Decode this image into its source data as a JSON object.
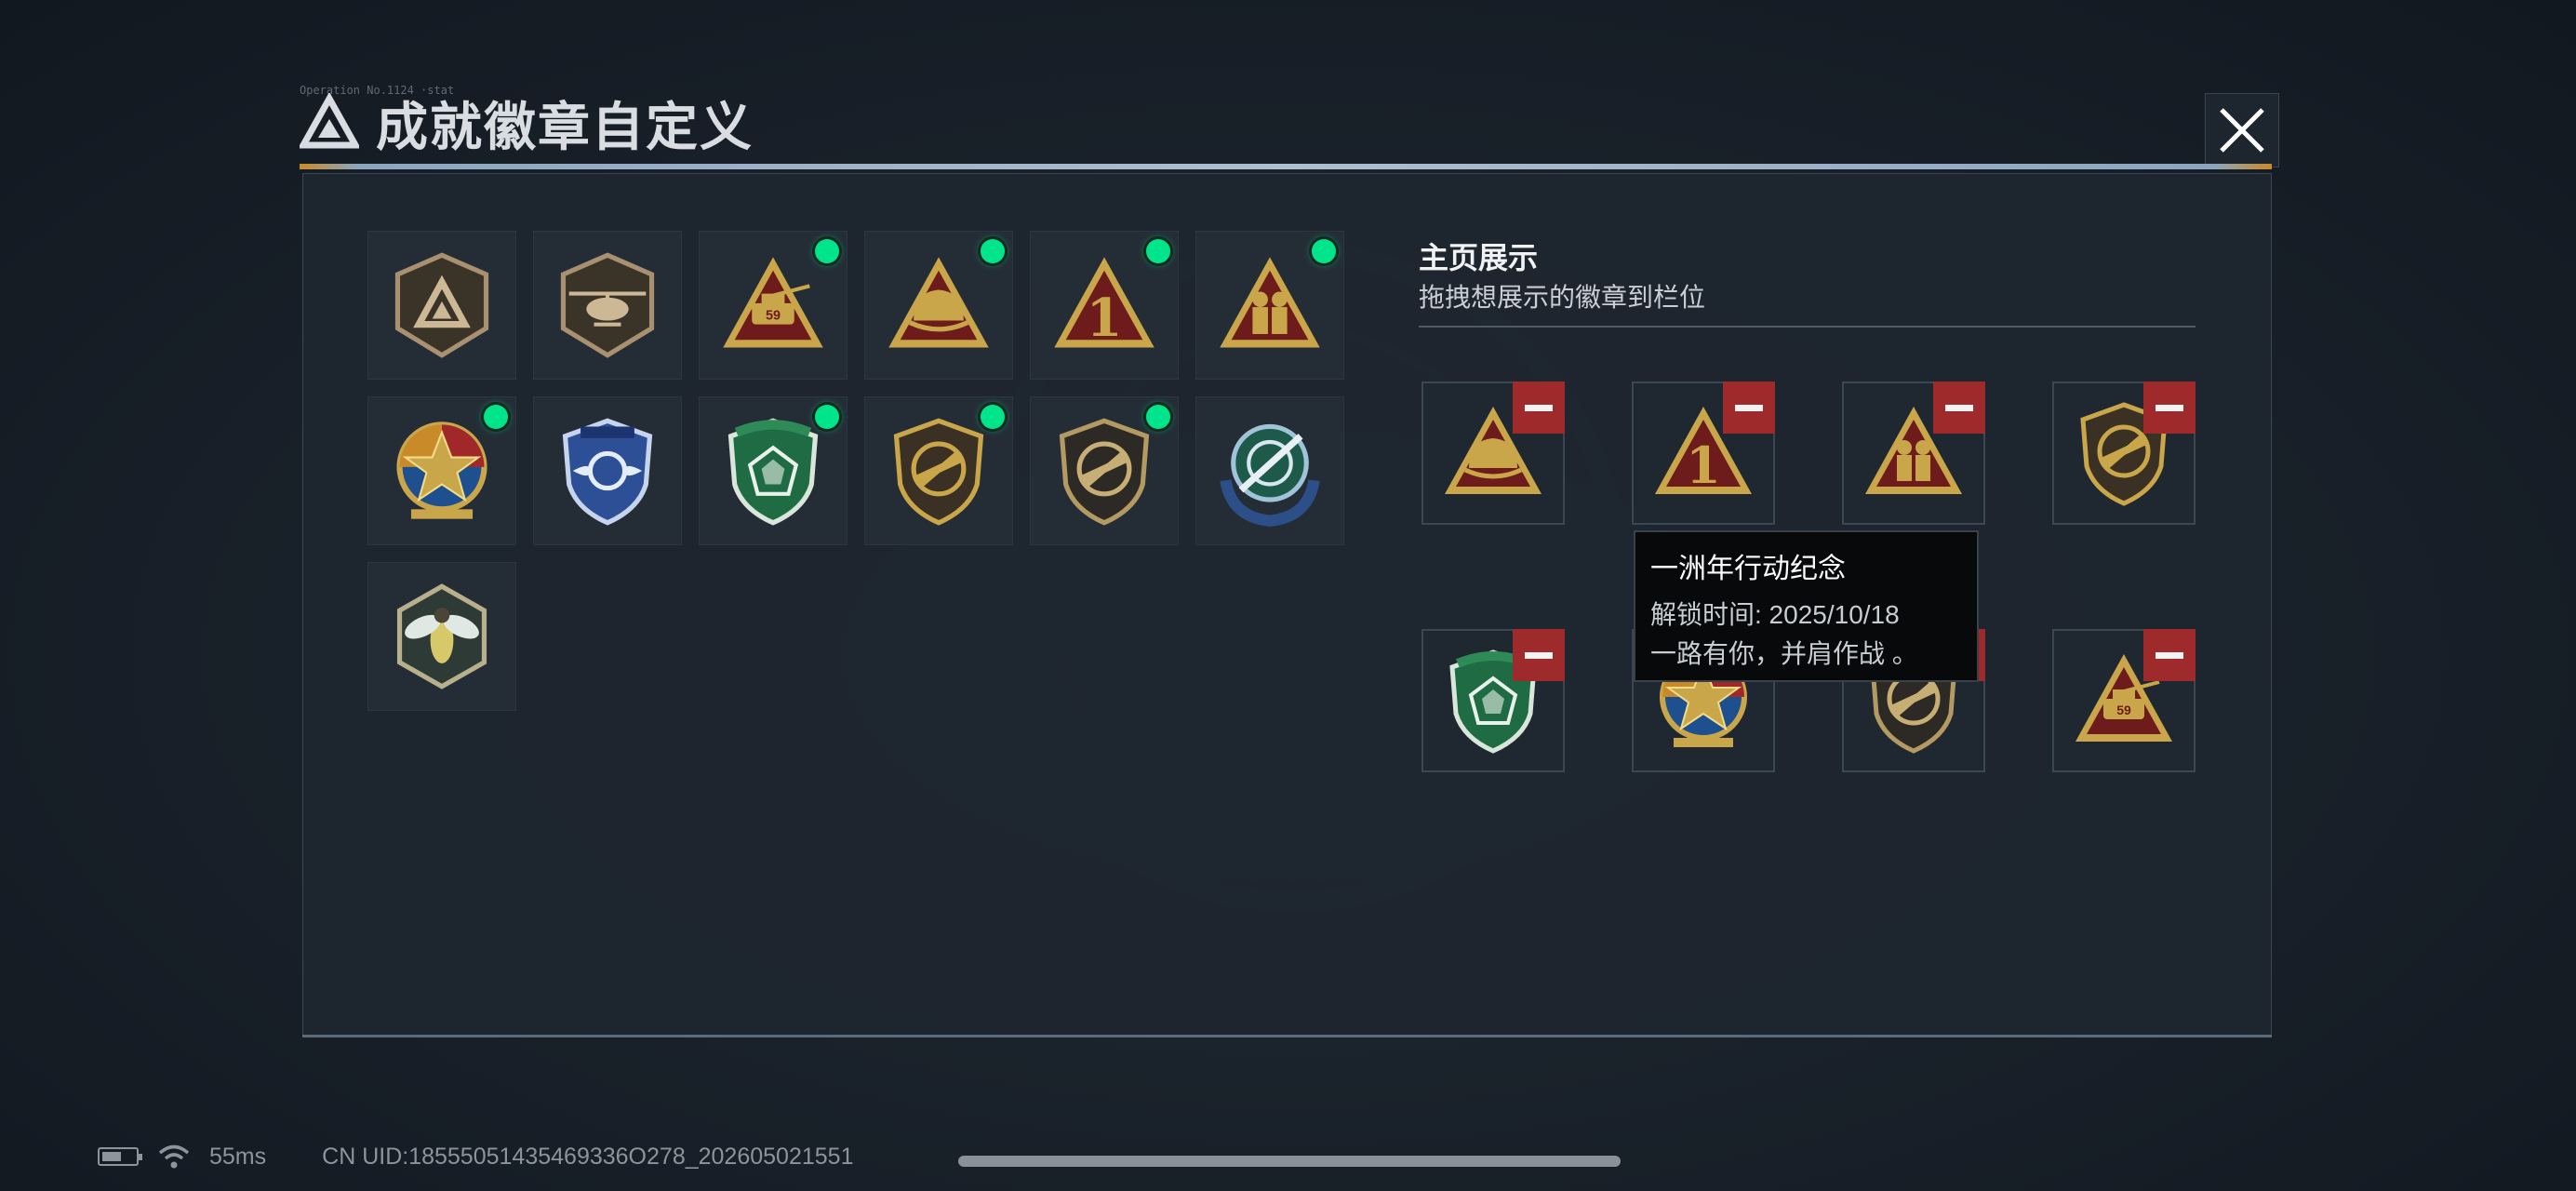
{
  "header": {
    "title": "成就徽章自定义",
    "caption": "Operation No.1124 ·stat",
    "close_icon": "close-icon",
    "accent_color": "#aebfcf"
  },
  "badge_collection": [
    {
      "id": "b1",
      "icon": "delta-shield-badge-icon",
      "equipped": false
    },
    {
      "id": "b2",
      "icon": "helicopter-shield-badge-icon",
      "equipped": false
    },
    {
      "id": "b3",
      "icon": "tank-59-triangle-badge-icon",
      "equipped": true
    },
    {
      "id": "b4",
      "icon": "helmet-triangle-badge-icon",
      "equipped": true
    },
    {
      "id": "b5",
      "icon": "number-one-triangle-badge-icon",
      "equipped": true
    },
    {
      "id": "b6",
      "icon": "soldiers-triangle-badge-icon",
      "equipped": true
    },
    {
      "id": "b7",
      "icon": "star-medal-badge-icon",
      "equipped": true
    },
    {
      "id": "b8",
      "icon": "blue-wings-shield-badge-icon",
      "equipped": false
    },
    {
      "id": "b9",
      "icon": "green-gem-shield-badge-icon",
      "equipped": true
    },
    {
      "id": "b10",
      "icon": "rifle-shield-badge-icon",
      "equipped": true
    },
    {
      "id": "b11",
      "icon": "rifle-shield-dark-badge-icon",
      "equipped": true
    },
    {
      "id": "b12",
      "icon": "blue-target-wreath-badge-icon",
      "equipped": false
    },
    {
      "id": "b13",
      "icon": "wasp-hexagon-badge-icon",
      "equipped": false
    }
  ],
  "display_section": {
    "title": "主页展示",
    "subtitle": "拖拽想展示的徽章到栏位",
    "slots": [
      {
        "icon": "helmet-triangle-badge-icon"
      },
      {
        "icon": "number-one-triangle-badge-icon"
      },
      {
        "icon": "soldiers-triangle-badge-icon"
      },
      {
        "icon": "rifle-shield-badge-icon"
      },
      {
        "icon": "green-gem-shield-badge-icon"
      },
      {
        "icon": "star-medal-badge-icon"
      },
      {
        "icon": "rifle-shield-dark-badge-icon"
      },
      {
        "icon": "tank-59-triangle-badge-icon"
      }
    ],
    "remove_icon": "minus-icon"
  },
  "tooltip": {
    "title": "一洲年行动纪念",
    "unlock_label": "解锁时间: 2025/10/18",
    "description": "一路有你，并肩作战 。"
  },
  "status_bar": {
    "ping": "55ms",
    "uid": "CN UID:18555051435469336O278_202605021551"
  },
  "colors": {
    "equipped_dot": "#00e58b",
    "remove_button": "#9e2a2b",
    "gold": "#c9a64a",
    "maroon": "#6e1b1b"
  }
}
